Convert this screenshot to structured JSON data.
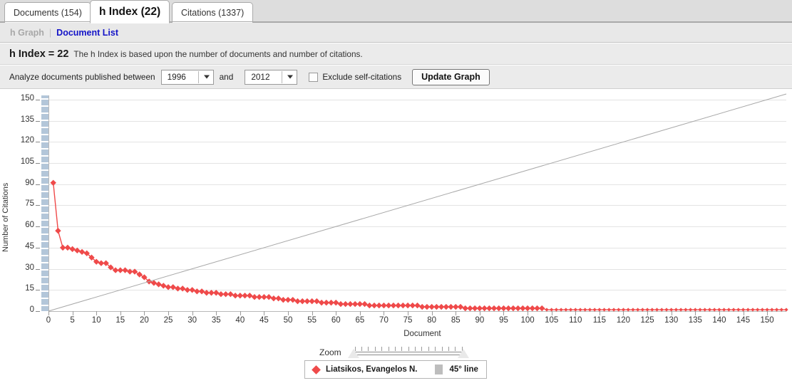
{
  "tabs": [
    {
      "label": "Documents (154)",
      "active": false
    },
    {
      "label": "h Index (22)",
      "active": true
    },
    {
      "label": "Citations (1337)",
      "active": false
    }
  ],
  "subnav": {
    "current": "h Graph",
    "separator": "|",
    "link": "Document List"
  },
  "info": {
    "h_index_label": "h Index = 22",
    "description": "The h Index is based upon the number of documents and number of citations."
  },
  "controls": {
    "analyze_label": "Analyze documents published between",
    "year_from": "1996",
    "year_to": "2012",
    "and_label": "and",
    "exclude_self_citations_label": "Exclude self-citations",
    "exclude_self_citations_checked": false,
    "update_button": "Update Graph"
  },
  "zoom_control": {
    "label": "Zoom",
    "tick_count": 17,
    "left_handle_pct": 0,
    "right_handle_pct": 100
  },
  "legend": {
    "series_name": "Liatsikos, Evangelos N.",
    "reference_name": "45° line",
    "series_color": "#ef4a4a",
    "reference_color": "#bdbdbd"
  },
  "chart_data": {
    "type": "line",
    "title": "",
    "xlabel": "Document",
    "ylabel": "Number of Citations",
    "xlim": [
      0,
      154
    ],
    "ylim": [
      0,
      153
    ],
    "grid": true,
    "legend_position": "bottom",
    "xticks": [
      0,
      5,
      10,
      15,
      20,
      25,
      30,
      35,
      40,
      45,
      50,
      55,
      60,
      65,
      70,
      75,
      80,
      85,
      90,
      95,
      100,
      105,
      110,
      115,
      120,
      125,
      130,
      135,
      140,
      145,
      150
    ],
    "yticks": [
      0,
      15,
      30,
      45,
      60,
      75,
      90,
      105,
      120,
      135,
      150
    ],
    "series": [
      {
        "name": "Liatsikos, Evangelos N.",
        "color": "#ef4a4a",
        "marker": "diamond",
        "x": [
          1,
          2,
          3,
          4,
          5,
          6,
          7,
          8,
          9,
          10,
          11,
          12,
          13,
          14,
          15,
          16,
          17,
          18,
          19,
          20,
          21,
          22,
          23,
          24,
          25,
          26,
          27,
          28,
          29,
          30,
          31,
          32,
          33,
          34,
          35,
          36,
          37,
          38,
          39,
          40,
          41,
          42,
          43,
          44,
          45,
          46,
          47,
          48,
          49,
          50,
          51,
          52,
          53,
          54,
          55,
          56,
          57,
          58,
          59,
          60,
          61,
          62,
          63,
          64,
          65,
          66,
          67,
          68,
          69,
          70,
          71,
          72,
          73,
          74,
          75,
          76,
          77,
          78,
          79,
          80,
          81,
          82,
          83,
          84,
          85,
          86,
          87,
          88,
          89,
          90,
          91,
          92,
          93,
          94,
          95,
          96,
          97,
          98,
          99,
          100,
          101,
          102,
          103,
          104,
          105,
          106,
          107,
          108,
          109,
          110,
          111,
          112,
          113,
          114,
          115,
          116,
          117,
          118,
          119,
          120,
          121,
          122,
          123,
          124,
          125,
          126,
          127,
          128,
          129,
          130,
          131,
          132,
          133,
          134,
          135,
          136,
          137,
          138,
          139,
          140,
          141,
          142,
          143,
          144,
          145,
          146,
          147,
          148,
          149,
          150,
          151,
          152,
          153,
          154
        ],
        "y": [
          91,
          57,
          45,
          45,
          44,
          43,
          42,
          41,
          38,
          35,
          34,
          34,
          31,
          29,
          29,
          29,
          28,
          28,
          26,
          24,
          21,
          20,
          19,
          18,
          17,
          17,
          16,
          16,
          15,
          15,
          14,
          14,
          13,
          13,
          13,
          12,
          12,
          12,
          11,
          11,
          11,
          11,
          10,
          10,
          10,
          10,
          9,
          9,
          8,
          8,
          8,
          7,
          7,
          7,
          7,
          7,
          6,
          6,
          6,
          6,
          5,
          5,
          5,
          5,
          5,
          5,
          4,
          4,
          4,
          4,
          4,
          4,
          4,
          4,
          4,
          4,
          4,
          3,
          3,
          3,
          3,
          3,
          3,
          3,
          3,
          3,
          2,
          2,
          2,
          2,
          2,
          2,
          2,
          2,
          2,
          2,
          2,
          2,
          2,
          2,
          2,
          2,
          2,
          1,
          1,
          1,
          1,
          1,
          1,
          1,
          1,
          1,
          1,
          1,
          1,
          1,
          1,
          1,
          1,
          1,
          1,
          1,
          1,
          1,
          1,
          1,
          1,
          1,
          1,
          1,
          1,
          1,
          1,
          1,
          1,
          1,
          1,
          1,
          1,
          1,
          1,
          1,
          1,
          1,
          1,
          1,
          1,
          1,
          1,
          1,
          1,
          1,
          1,
          1
        ]
      },
      {
        "name": "45° line",
        "color": "#a8a8a8",
        "marker": "none",
        "x": [
          0,
          154
        ],
        "y": [
          0,
          154
        ]
      }
    ]
  }
}
